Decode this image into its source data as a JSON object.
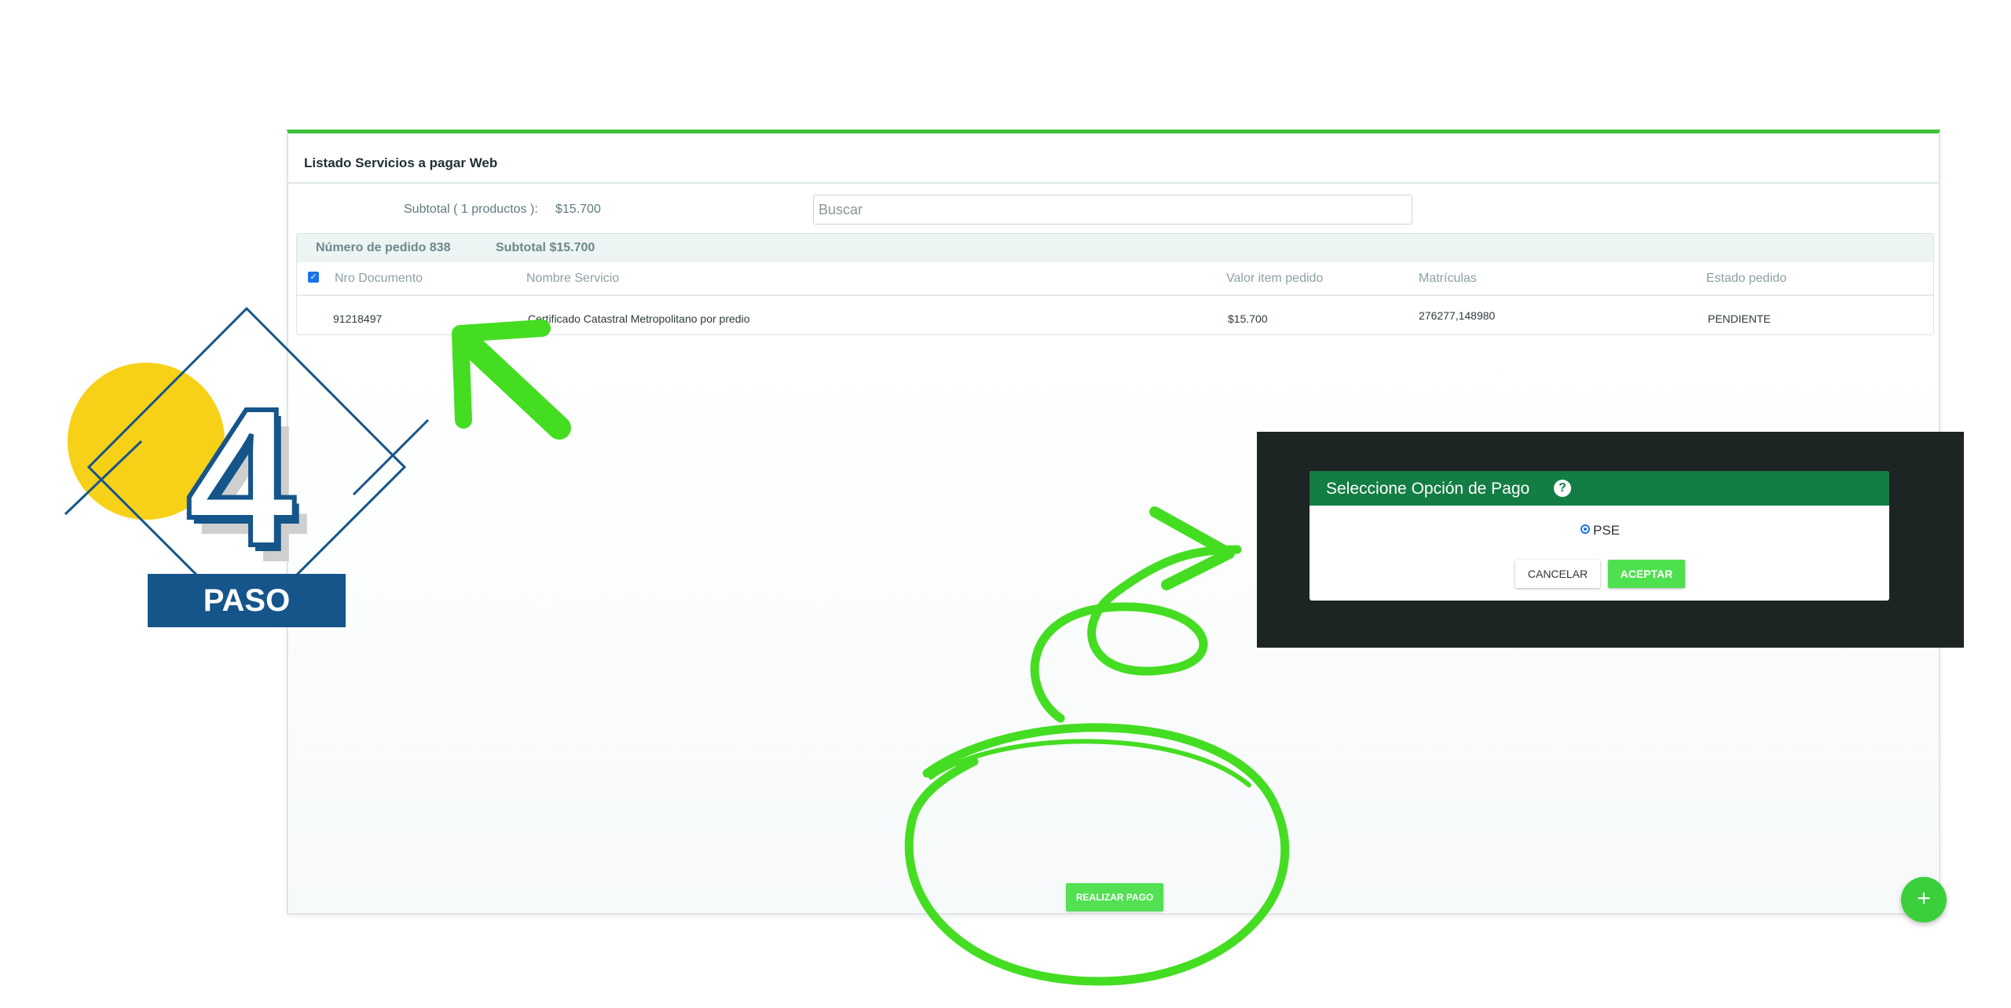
{
  "card": {
    "title": "Listado Servicios a pagar Web",
    "subtotal_label": "Subtotal ( 1 productos ):",
    "subtotal_value": "$15.700",
    "search_placeholder": "Buscar"
  },
  "order": {
    "number": "Número de pedido 838",
    "subtotal": "Subtotal $15.700",
    "columns": [
      "Nro Documento",
      "Nombre Servicio",
      "Valor item pedido",
      "Matrículas",
      "Estado pedido"
    ],
    "rows": [
      {
        "document": "91218497",
        "service": "Certificado Catastral Metropolitano por predio",
        "value": "$15.700",
        "matriculas": "276277,148980",
        "status": "PENDIENTE"
      }
    ]
  },
  "pay_button": "REALIZAR PAGO",
  "fab_label": "+",
  "dialog": {
    "title": "Seleccione Opción de Pago",
    "help_glyph": "?",
    "option": "PSE",
    "cancel": "CANCELAR",
    "accept": "ACEPTAR"
  },
  "badge": {
    "number": "4",
    "label": "PASO"
  },
  "colors": {
    "accent_green": "#3dc23d",
    "dialog_header": "#137d43",
    "badge_blue": "#15558a",
    "badge_yellow": "#f7d117",
    "annotation_green": "#44dd22"
  }
}
